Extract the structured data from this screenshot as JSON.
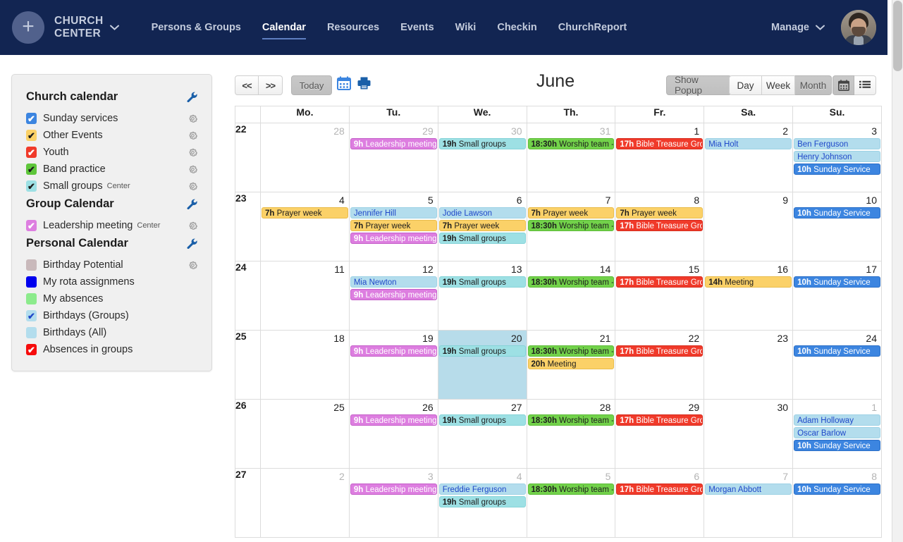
{
  "nav": {
    "brand_line1": "CHURCH",
    "brand_line2": "CENTER",
    "brand_caret": "⌄",
    "plus_icon": "+",
    "links": [
      {
        "label": "Persons & Groups",
        "active": false
      },
      {
        "label": "Calendar",
        "active": true
      },
      {
        "label": "Resources",
        "active": false
      },
      {
        "label": "Events",
        "active": false
      },
      {
        "label": "Wiki",
        "active": false
      },
      {
        "label": "Checkin",
        "active": false
      },
      {
        "label": "ChurchReport",
        "active": false
      }
    ],
    "manage_label": "Manage",
    "manage_caret": "⌄"
  },
  "sidebar": {
    "sections": [
      {
        "title": "Church calendar",
        "items": [
          {
            "label": "Sunday services",
            "sub": "",
            "color": "#3c85e0",
            "checked": true,
            "tick_color": "#ffffff",
            "gear": true
          },
          {
            "label": "Other Events",
            "sub": "",
            "color": "#fbd168",
            "checked": true,
            "tick_color": "#1d1d1d",
            "gear": true
          },
          {
            "label": "Youth",
            "sub": "",
            "color": "#f03a2a",
            "checked": true,
            "tick_color": "#ffffff",
            "gear": true
          },
          {
            "label": "Band practice",
            "sub": "",
            "color": "#5ec63a",
            "checked": true,
            "tick_color": "#1d1d1d",
            "gear": true
          },
          {
            "label": "Small groups",
            "sub": "Center",
            "color": "#9de0e4",
            "checked": true,
            "tick_color": "#1d1d1d",
            "gear": true
          }
        ]
      },
      {
        "title": "Group Calendar",
        "items": [
          {
            "label": "Leadership meeting",
            "sub": "Center",
            "color": "#dd7ee0",
            "checked": true,
            "tick_color": "#ffffff",
            "gear": true
          }
        ]
      },
      {
        "title": "Personal Calendar",
        "items": [
          {
            "label": "Birthday Potential",
            "sub": "",
            "color": "#c9b9bb",
            "checked": false,
            "tick_color": "#1d1d1d",
            "gear": true
          },
          {
            "label": "My rota assignmens",
            "sub": "",
            "color": "#0000ee",
            "checked": false,
            "tick_color": "#ffffff",
            "gear": false
          },
          {
            "label": "My absences",
            "sub": "",
            "color": "#8ceb8c",
            "checked": false,
            "tick_color": "#1d1d1d",
            "gear": false
          },
          {
            "label": "Birthdays (Groups)",
            "sub": "",
            "color": "#b3dded",
            "checked": true,
            "tick_color": "#1f48c9",
            "gear": false
          },
          {
            "label": "Birthdays (All)",
            "sub": "",
            "color": "#b3dded",
            "checked": false,
            "tick_color": "#1f48c9",
            "gear": false
          },
          {
            "label": "Absences in groups",
            "sub": "",
            "color": "#f60c0c",
            "checked": true,
            "tick_color": "#ffffff",
            "gear": false
          }
        ]
      }
    ],
    "wrench_icon": "wrench-icon",
    "gear_icon": "gear-icon"
  },
  "toolbar": {
    "prev_label": "<<",
    "next_label": ">>",
    "today_label": "Today",
    "calendar_icon": "calendar-icon",
    "print_icon": "print-icon",
    "month_title": "June",
    "show_popup_label": "Show Popup",
    "views": [
      {
        "label": "Day",
        "active": false
      },
      {
        "label": "Week",
        "active": false
      },
      {
        "label": "Month",
        "active": true
      }
    ],
    "modes": [
      {
        "icon": "calendar-view-icon",
        "active": true
      },
      {
        "icon": "list-view-icon",
        "active": false
      }
    ]
  },
  "calendar": {
    "weekday_headers": [
      "",
      "Mo.",
      "Tu.",
      "We.",
      "Th.",
      "Fr.",
      "Sa.",
      "Su."
    ],
    "weeks": [
      {
        "week_number": "22",
        "days": [
          {
            "num": "28",
            "other_month": true,
            "today": false,
            "events": []
          },
          {
            "num": "29",
            "other_month": true,
            "today": false,
            "events": [
              {
                "time": "9h",
                "title": "Leadership meeting",
                "color": "purple"
              }
            ]
          },
          {
            "num": "30",
            "other_month": true,
            "today": false,
            "events": [
              {
                "time": "19h",
                "title": "Small groups",
                "color": "cyan"
              }
            ]
          },
          {
            "num": "31",
            "other_month": true,
            "today": false,
            "events": [
              {
                "time": "18:30h",
                "title": "Worship team -",
                "color": "green"
              }
            ]
          },
          {
            "num": "1",
            "other_month": false,
            "today": false,
            "events": [
              {
                "time": "17h",
                "title": "Bible Treasure Gro",
                "color": "red"
              }
            ]
          },
          {
            "num": "2",
            "other_month": false,
            "today": false,
            "events": [
              {
                "time": "",
                "title": "Mia Holt",
                "color": "ltblue"
              }
            ]
          },
          {
            "num": "3",
            "other_month": false,
            "today": false,
            "events": [
              {
                "time": "",
                "title": "Ben Ferguson",
                "color": "ltblue"
              },
              {
                "time": "",
                "title": "Henry Johnson",
                "color": "ltblue"
              },
              {
                "time": "10h",
                "title": "Sunday Service",
                "color": "blue"
              }
            ]
          }
        ]
      },
      {
        "week_number": "23",
        "days": [
          {
            "num": "4",
            "other_month": false,
            "today": false,
            "events": [
              {
                "time": "7h",
                "title": "Prayer week",
                "color": "yellow"
              }
            ]
          },
          {
            "num": "5",
            "other_month": false,
            "today": false,
            "events": [
              {
                "time": "",
                "title": "Jennifer Hill",
                "color": "ltblue"
              },
              {
                "time": "7h",
                "title": "Prayer week",
                "color": "yellow"
              },
              {
                "time": "9h",
                "title": "Leadership meeting",
                "color": "purple"
              }
            ]
          },
          {
            "num": "6",
            "other_month": false,
            "today": false,
            "events": [
              {
                "time": "",
                "title": "Jodie Lawson",
                "color": "ltblue"
              },
              {
                "time": "7h",
                "title": "Prayer week",
                "color": "yellow"
              },
              {
                "time": "19h",
                "title": "Small groups",
                "color": "cyan"
              }
            ]
          },
          {
            "num": "7",
            "other_month": false,
            "today": false,
            "events": [
              {
                "time": "7h",
                "title": "Prayer week",
                "color": "yellow"
              },
              {
                "time": "18:30h",
                "title": "Worship team -",
                "color": "green"
              }
            ]
          },
          {
            "num": "8",
            "other_month": false,
            "today": false,
            "events": [
              {
                "time": "7h",
                "title": "Prayer week",
                "color": "yellow"
              },
              {
                "time": "17h",
                "title": "Bible Treasure Gro",
                "color": "red"
              }
            ]
          },
          {
            "num": "9",
            "other_month": false,
            "today": false,
            "events": []
          },
          {
            "num": "10",
            "other_month": false,
            "today": false,
            "events": [
              {
                "time": "10h",
                "title": "Sunday Service",
                "color": "blue"
              }
            ]
          }
        ]
      },
      {
        "week_number": "24",
        "days": [
          {
            "num": "11",
            "other_month": false,
            "today": false,
            "events": []
          },
          {
            "num": "12",
            "other_month": false,
            "today": false,
            "events": [
              {
                "time": "",
                "title": "Mia Newton",
                "color": "ltblue"
              },
              {
                "time": "9h",
                "title": "Leadership meeting",
                "color": "purple"
              }
            ]
          },
          {
            "num": "13",
            "other_month": false,
            "today": false,
            "events": [
              {
                "time": "19h",
                "title": "Small groups",
                "color": "cyan"
              }
            ]
          },
          {
            "num": "14",
            "other_month": false,
            "today": false,
            "events": [
              {
                "time": "18:30h",
                "title": "Worship team -",
                "color": "green"
              }
            ]
          },
          {
            "num": "15",
            "other_month": false,
            "today": false,
            "events": [
              {
                "time": "17h",
                "title": "Bible Treasure Gro",
                "color": "red"
              }
            ]
          },
          {
            "num": "16",
            "other_month": false,
            "today": false,
            "events": [
              {
                "time": "14h",
                "title": "Meeting",
                "color": "yellow"
              }
            ]
          },
          {
            "num": "17",
            "other_month": false,
            "today": false,
            "events": [
              {
                "time": "10h",
                "title": "Sunday Service",
                "color": "blue"
              }
            ]
          }
        ]
      },
      {
        "week_number": "25",
        "days": [
          {
            "num": "18",
            "other_month": false,
            "today": false,
            "events": []
          },
          {
            "num": "19",
            "other_month": false,
            "today": false,
            "events": [
              {
                "time": "9h",
                "title": "Leadership meeting",
                "color": "purple"
              }
            ]
          },
          {
            "num": "20",
            "other_month": false,
            "today": true,
            "events": [
              {
                "time": "19h",
                "title": "Small groups",
                "color": "cyan"
              }
            ]
          },
          {
            "num": "21",
            "other_month": false,
            "today": false,
            "events": [
              {
                "time": "18:30h",
                "title": "Worship team -",
                "color": "green"
              },
              {
                "time": "20h",
                "title": "Meeting",
                "color": "yellow"
              }
            ]
          },
          {
            "num": "22",
            "other_month": false,
            "today": false,
            "events": [
              {
                "time": "17h",
                "title": "Bible Treasure Gro",
                "color": "red"
              }
            ]
          },
          {
            "num": "23",
            "other_month": false,
            "today": false,
            "events": []
          },
          {
            "num": "24",
            "other_month": false,
            "today": false,
            "events": [
              {
                "time": "10h",
                "title": "Sunday Service",
                "color": "blue"
              }
            ]
          }
        ]
      },
      {
        "week_number": "26",
        "days": [
          {
            "num": "25",
            "other_month": false,
            "today": false,
            "events": []
          },
          {
            "num": "26",
            "other_month": false,
            "today": false,
            "events": [
              {
                "time": "9h",
                "title": "Leadership meeting",
                "color": "purple"
              }
            ]
          },
          {
            "num": "27",
            "other_month": false,
            "today": false,
            "events": [
              {
                "time": "19h",
                "title": "Small groups",
                "color": "cyan"
              }
            ]
          },
          {
            "num": "28",
            "other_month": false,
            "today": false,
            "events": [
              {
                "time": "18:30h",
                "title": "Worship team -",
                "color": "green"
              }
            ]
          },
          {
            "num": "29",
            "other_month": false,
            "today": false,
            "events": [
              {
                "time": "17h",
                "title": "Bible Treasure Gro",
                "color": "red"
              }
            ]
          },
          {
            "num": "30",
            "other_month": false,
            "today": false,
            "events": []
          },
          {
            "num": "1",
            "other_month": true,
            "today": false,
            "events": [
              {
                "time": "",
                "title": "Adam Holloway",
                "color": "ltblue"
              },
              {
                "time": "",
                "title": "Oscar Barlow",
                "color": "ltblue"
              },
              {
                "time": "10h",
                "title": "Sunday Service",
                "color": "blue"
              }
            ]
          }
        ]
      },
      {
        "week_number": "27",
        "days": [
          {
            "num": "2",
            "other_month": true,
            "today": false,
            "events": []
          },
          {
            "num": "3",
            "other_month": true,
            "today": false,
            "events": [
              {
                "time": "9h",
                "title": "Leadership meeting",
                "color": "purple"
              }
            ]
          },
          {
            "num": "4",
            "other_month": true,
            "today": false,
            "events": [
              {
                "time": "",
                "title": "Freddie Ferguson",
                "color": "ltblue"
              },
              {
                "time": "19h",
                "title": "Small groups",
                "color": "cyan"
              }
            ]
          },
          {
            "num": "5",
            "other_month": true,
            "today": false,
            "events": [
              {
                "time": "18:30h",
                "title": "Worship team -",
                "color": "green"
              }
            ]
          },
          {
            "num": "6",
            "other_month": true,
            "today": false,
            "events": [
              {
                "time": "17h",
                "title": "Bible Treasure Gro",
                "color": "red"
              }
            ]
          },
          {
            "num": "7",
            "other_month": true,
            "today": false,
            "events": [
              {
                "time": "",
                "title": "Morgan Abbott",
                "color": "ltblue"
              }
            ]
          },
          {
            "num": "8",
            "other_month": true,
            "today": false,
            "events": [
              {
                "time": "10h",
                "title": "Sunday Service",
                "color": "blue"
              }
            ]
          }
        ]
      }
    ]
  },
  "colors": {
    "navbar": "#122552",
    "today_highlight": "#b7dcea",
    "accent_link": "#1a5fa8"
  }
}
